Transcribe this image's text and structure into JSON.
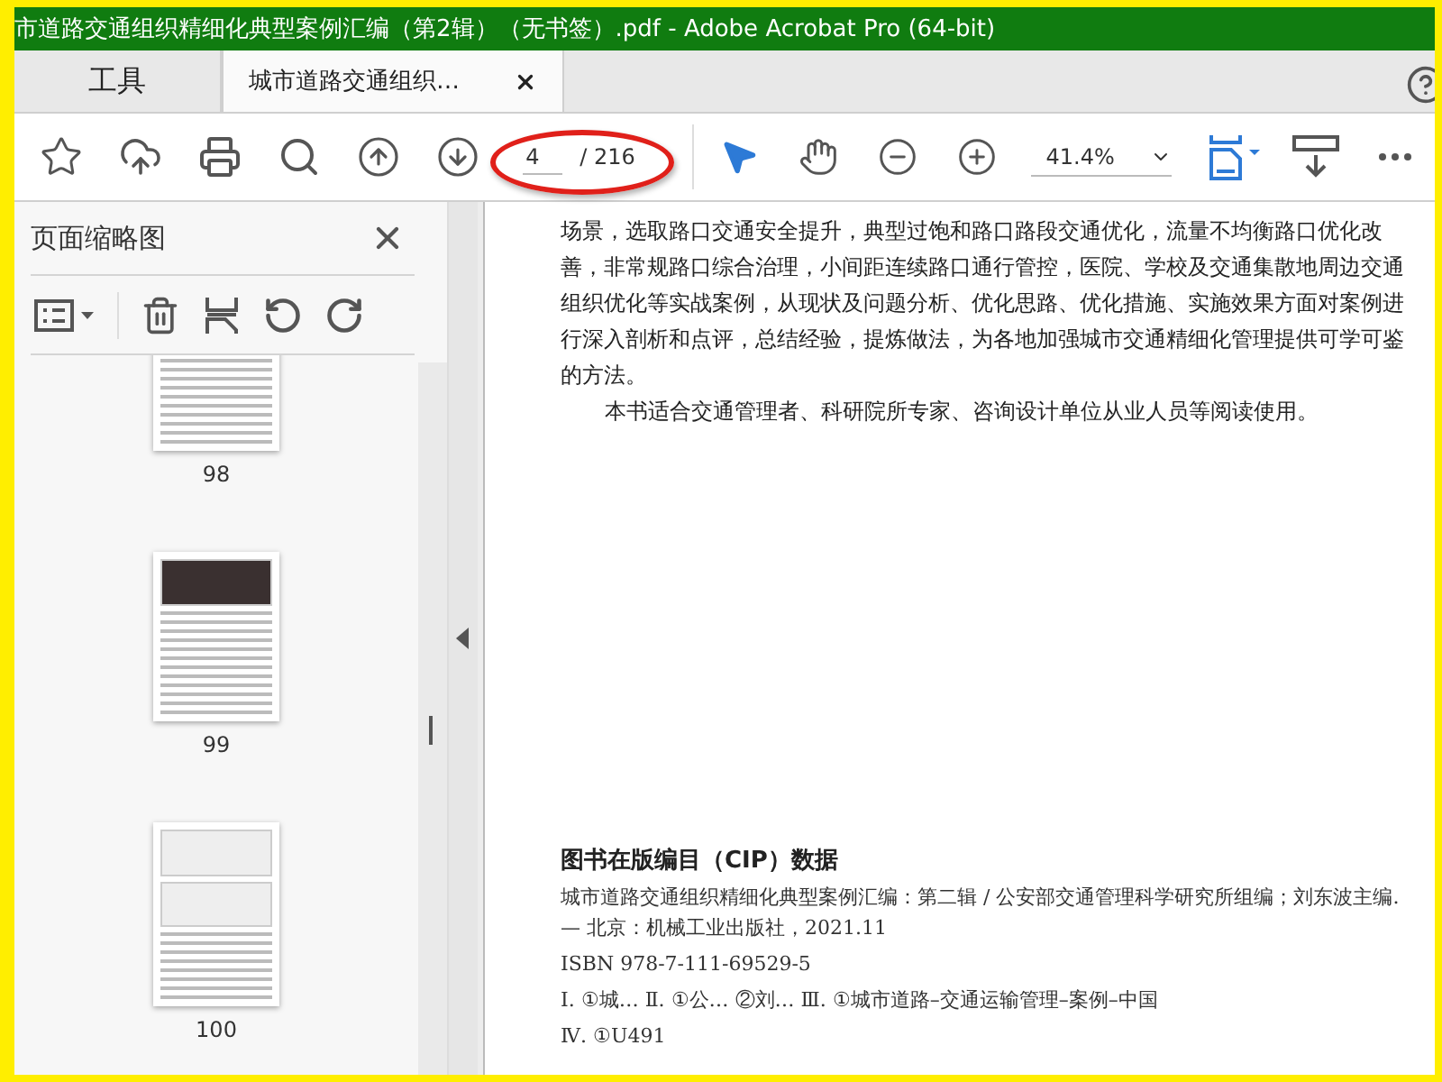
{
  "window": {
    "title": "市道路交通组织精细化典型案例汇编（第2辑）（无书签）.pdf - Adobe Acrobat Pro (64-bit)"
  },
  "tabs": [
    {
      "label": "工具",
      "selected": false
    },
    {
      "label": "城市道路交通组织…",
      "selected": true
    }
  ],
  "toolbar": {
    "page_current": "4",
    "page_total": "/ 216",
    "zoom": "41.4%"
  },
  "thumbnails_panel": {
    "title": "页面缩略图",
    "pages": [
      {
        "label": "98",
        "kind": "text"
      },
      {
        "label": "99",
        "kind": "photo"
      },
      {
        "label": "100",
        "kind": "diagram"
      }
    ]
  },
  "document": {
    "paragraphs": [
      "场景，选取路口交通安全提升，典型过饱和路口路段交通优化，流量不均衡路口优化改善，非常规路口综合治理，小间距连续路口通行管控，医院、学校及交通集散地周边交通组织优化等实战案例，从现状及问题分析、优化思路、优化措施、实施效果方面对案例进行深入剖析和点评，总结经验，提炼做法，为各地加强城市交通精细化管理提供可学可鉴的方法。",
      "本书适合交通管理者、科研院所专家、咨询设计单位从业人员等阅读使用。"
    ],
    "cip_heading": "图书在版编目（CIP）数据",
    "cip_lines": [
      "城市道路交通组织精细化典型案例汇编：第二辑 / 公安部交通管理科学研究所组编；刘东波主编. — 北京：机械工业出版社，2021.11",
      "ISBN 978-7-111-69529-5",
      "Ⅰ. ①城…  Ⅱ. ①公…  ②刘…  Ⅲ. ①城市道路–交通运输管理–案例–中国",
      "Ⅳ. ①U491"
    ]
  }
}
